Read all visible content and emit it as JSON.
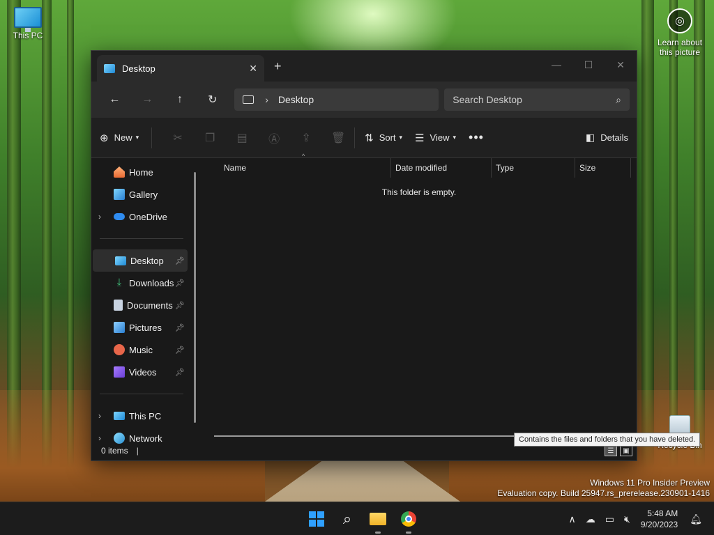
{
  "desktop": {
    "icons": {
      "this_pc": "This PC",
      "learn": "Learn about this picture",
      "recycle_bin": "Recycle Bin"
    },
    "tooltip": "Contains the files and folders that you have deleted.",
    "watermark": {
      "line1": "Windows 11 Pro Insider Preview",
      "line2": "Evaluation copy. Build 25947.rs_prerelease.230901-1416"
    }
  },
  "explorer": {
    "tab_title": "Desktop",
    "new_tab_symbol": "+",
    "address": {
      "location": "Desktop",
      "search_placeholder": "Search Desktop"
    },
    "commands": {
      "new": "New",
      "sort": "Sort",
      "view": "View",
      "more": "•••",
      "details": "Details"
    },
    "nav": {
      "home": "Home",
      "gallery": "Gallery",
      "onedrive": "OneDrive",
      "desktop": "Desktop",
      "downloads": "Downloads",
      "documents": "Documents",
      "pictures": "Pictures",
      "music": "Music",
      "videos": "Videos",
      "this_pc": "This PC",
      "network": "Network"
    },
    "columns": [
      "Name",
      "Date modified",
      "Type",
      "Size"
    ],
    "empty_message": "This folder is empty.",
    "status": "0 items"
  },
  "taskbar": {
    "time": "5:48 AM",
    "date": "9/20/2023"
  }
}
